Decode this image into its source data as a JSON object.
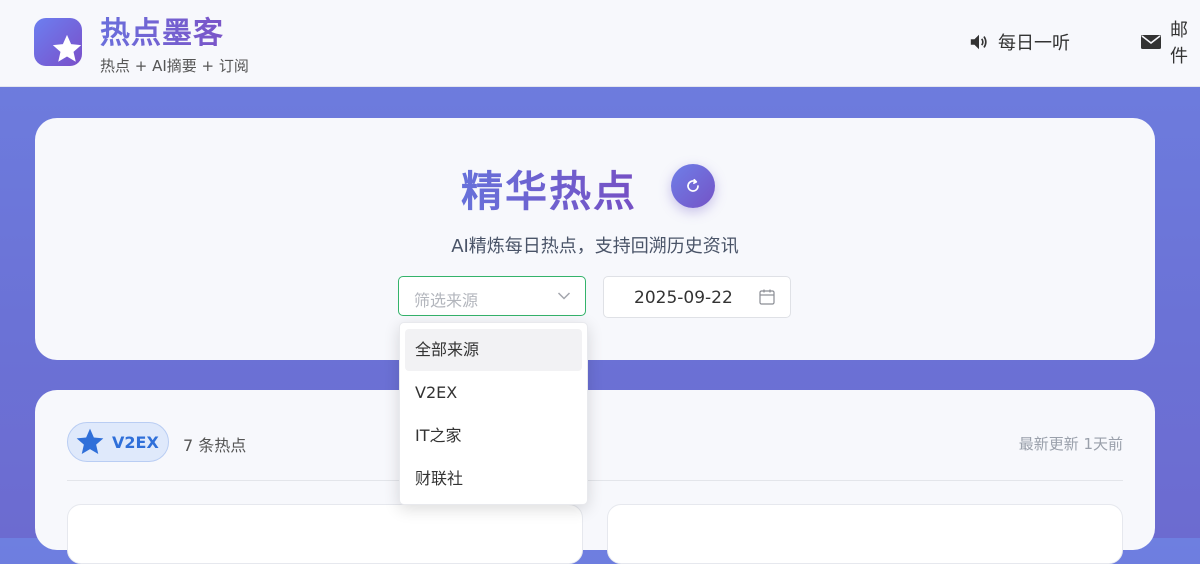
{
  "header": {
    "brand_title": "热点墨客",
    "brand_subtitle": "热点 + AI摘要 + 订阅",
    "nav": [
      {
        "label": "每日一听",
        "icon": "speaker-icon"
      },
      {
        "label": "邮件",
        "icon": "mail-icon"
      }
    ]
  },
  "hero": {
    "title": "精华热点",
    "subtitle": "AI精炼每日热点，支持回溯历史资讯",
    "source_select_placeholder": "筛选来源",
    "date_value": "2025-09-22"
  },
  "dropdown": {
    "options": [
      "全部来源",
      "V2EX",
      "IT之家",
      "财联社"
    ],
    "highlighted": "全部来源"
  },
  "content": {
    "source_name": "V2EX",
    "count_text": "7 条热点",
    "updated_text": "最新更新 1天前"
  },
  "colors": {
    "accent": "#6a5acd",
    "select_border": "#34b36b",
    "pill_text": "#2f6fd9"
  }
}
